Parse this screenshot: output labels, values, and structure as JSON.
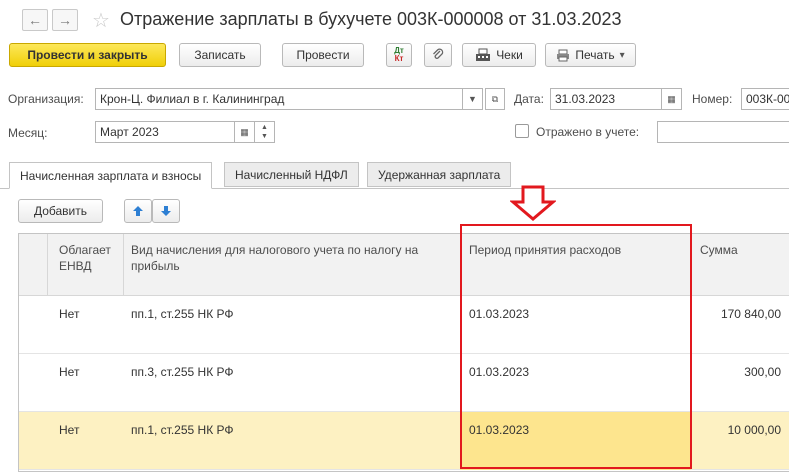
{
  "title": "Отражение зарплаты в бухучете 003К-000008 от 31.03.2023",
  "nav": {
    "back": "←",
    "forward": "→",
    "favorite": "☆"
  },
  "toolbar": {
    "post_close": "Провести и закрыть",
    "save": "Записать",
    "post": "Провести",
    "dtkt_top": "Дт",
    "dtkt_bottom": "Кт",
    "attach": "📎",
    "checks": "Чеки",
    "print": "Печать",
    "print_caret": "▾"
  },
  "form": {
    "org_label": "Организация:",
    "org_value": "Крон-Ц. Филиал в г. Калининград",
    "date_label": "Дата:",
    "date_value": "31.03.2023",
    "number_label": "Номер:",
    "number_value": "003К-00",
    "month_label": "Месяц:",
    "month_value": "Март 2023",
    "reflected_label": "Отражено в учете:",
    "reflected_value": ""
  },
  "tabs": [
    {
      "label": "Начисленная зарплата и взносы"
    },
    {
      "label": "Начисленный НДФЛ"
    },
    {
      "label": "Удержанная зарплата"
    }
  ],
  "table_toolbar": {
    "add": "Добавить",
    "up": "🡅",
    "down": "🡇"
  },
  "table": {
    "columns": [
      "Облагает ЕНВД",
      "Вид начисления для налогового учета по налогу на прибыль",
      "Период принятия расходов",
      "Сумма"
    ],
    "rows": [
      {
        "envd": "Нет",
        "type": "пп.1, ст.255 НК РФ",
        "period": "01.03.2023",
        "sum": "170 840,00"
      },
      {
        "envd": "Нет",
        "type": "пп.3, ст.255 НК РФ",
        "period": "01.03.2023",
        "sum": "300,00"
      },
      {
        "envd": "Нет",
        "type": "пп.1, ст.255 НК РФ",
        "period": "01.03.2023",
        "sum": "10 000,00"
      }
    ],
    "selected_row": 2
  },
  "colors": {
    "primary": "#f5d31a",
    "highlight": "#e2181e",
    "selected_row": "#fdf1c2"
  }
}
